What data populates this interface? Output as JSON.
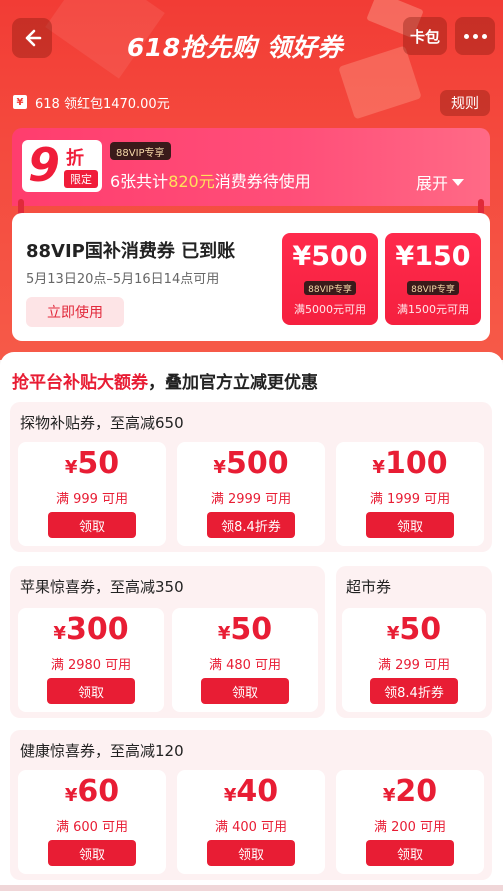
{
  "header": {
    "title": "618抢先购 领好券",
    "card_label": "卡包",
    "back_icon": "back-arrow-icon",
    "more_icon": "more-dots-icon"
  },
  "redpack": {
    "icon_label": "¥",
    "text": "618 领红包1470.00元"
  },
  "rules_label": "规则",
  "discount": {
    "badge_num": "9",
    "badge_unit": "折",
    "badge_limit": "限定",
    "vip_tag": "88VIP专享",
    "text_pre": "6张共计",
    "text_amount": "820元",
    "text_post": "消费券待使用",
    "expand_label": "展开"
  },
  "vip_card": {
    "title": "88VIP国补消费券 已到账",
    "date": "5月13日20点–5月16日14点可用",
    "use_label": "立即使用",
    "coupons": [
      {
        "amount": "¥500",
        "tag": "88VIP专享",
        "cond": "满5000元可用"
      },
      {
        "amount": "¥150",
        "tag": "88VIP专享",
        "cond": "满1500元可用"
      }
    ]
  },
  "main": {
    "section_title_red": "抢平台补贴大额券",
    "section_title_rest": "，叠加官方立减更优惠",
    "groups": [
      {
        "title": "探物补贴券，至高减650",
        "coupons": [
          {
            "yen": "¥",
            "amount": "50",
            "cond": "满 999 可用",
            "btn": "领取"
          },
          {
            "yen": "¥",
            "amount": "500",
            "cond": "满 2999 可用",
            "btn": "领8.4折券"
          },
          {
            "yen": "¥",
            "amount": "100",
            "cond": "满 1999 可用",
            "btn": "领取"
          }
        ]
      },
      {
        "title": "苹果惊喜券，至高减350",
        "coupons": [
          {
            "yen": "¥",
            "amount": "300",
            "cond": "满 2980 可用",
            "btn": "领取"
          },
          {
            "yen": "¥",
            "amount": "50",
            "cond": "满 480 可用",
            "btn": "领取"
          }
        ]
      },
      {
        "title": "超市券",
        "coupons": [
          {
            "yen": "¥",
            "amount": "50",
            "cond": "满 299 可用",
            "btn": "领8.4折券"
          }
        ]
      },
      {
        "title": "健康惊喜券，至高减120",
        "coupons": [
          {
            "yen": "¥",
            "amount": "60",
            "cond": "满 600 可用",
            "btn": "领取"
          },
          {
            "yen": "¥",
            "amount": "40",
            "cond": "满 400 可用",
            "btn": "领取"
          },
          {
            "yen": "¥",
            "amount": "20",
            "cond": "满 200 可用",
            "btn": "领取"
          }
        ]
      }
    ]
  }
}
